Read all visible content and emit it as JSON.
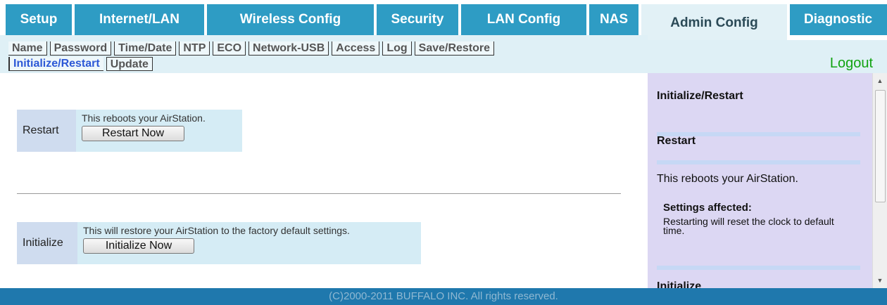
{
  "nav": {
    "tabs": [
      {
        "label": "Setup"
      },
      {
        "label": "Internet/LAN"
      },
      {
        "label": "Wireless Config"
      },
      {
        "label": "Security"
      },
      {
        "label": "LAN Config"
      },
      {
        "label": "NAS"
      },
      {
        "label": "Admin Config"
      },
      {
        "label": "Diagnostic"
      }
    ],
    "active_index": 6
  },
  "subnav": {
    "row1": [
      "Name",
      "Password",
      "Time/Date",
      "NTP",
      "ECO",
      "Network-USB",
      "Access",
      "Log",
      "Save/Restore"
    ],
    "row2": [
      "Initialize/Restart",
      "Update"
    ],
    "active": "Initialize/Restart"
  },
  "logout": "Logout",
  "restart": {
    "label": "Restart",
    "desc": "This reboots your AirStation.",
    "button": "Restart Now"
  },
  "initialize": {
    "label": "Initialize",
    "desc": "This will restore your AirStation to the factory default settings.",
    "button": "Initialize Now"
  },
  "help": {
    "title": "Initialize/Restart",
    "restart_heading": "Restart",
    "restart_text": "This reboots your AirStation.",
    "settings_affected": "Settings affected:",
    "settings_text": "Restarting will reset the clock to default time.",
    "initialize_heading": "Initialize"
  },
  "footer": "(C)2000-2011 BUFFALO INC. All rights reserved.",
  "colors": {
    "nav_bg": "#2e9cc4",
    "footer_bg": "#1f78ad",
    "help_bg": "#dcd7f3",
    "logout": "#11a311"
  }
}
